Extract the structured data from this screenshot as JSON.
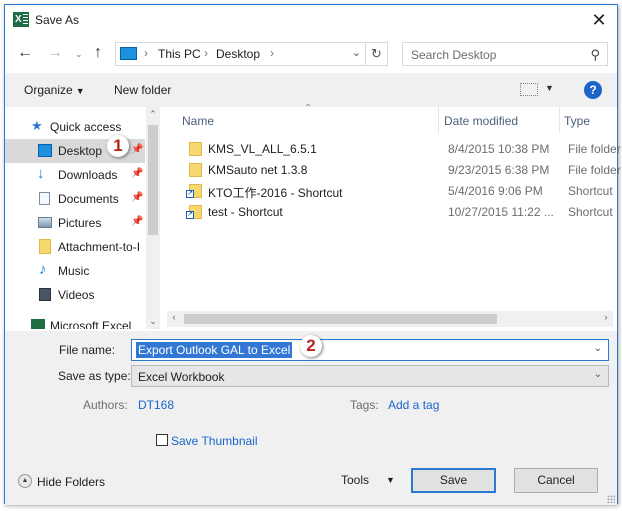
{
  "window": {
    "title": "Save As",
    "app_icon": "excel-icon",
    "accent": "#2a7ad2"
  },
  "navigation": {
    "back": "arrow-left-icon",
    "forward": "arrow-right-icon",
    "recent": "chevron-down-icon",
    "up": "arrow-up-icon",
    "breadcrumb": [
      "This PC",
      "Desktop"
    ],
    "search_placeholder": "Search Desktop"
  },
  "toolbar": {
    "organize": "Organize",
    "new_folder": "New folder"
  },
  "nav_pane": {
    "items": [
      {
        "label": "Quick access",
        "icon": "star-icon",
        "pinned": false
      },
      {
        "label": "Desktop",
        "icon": "desktop-icon",
        "pinned": true,
        "selected": true
      },
      {
        "label": "Downloads",
        "icon": "download-icon",
        "pinned": true
      },
      {
        "label": "Documents",
        "icon": "documents-icon",
        "pinned": true
      },
      {
        "label": "Pictures",
        "icon": "pictures-icon",
        "pinned": true
      },
      {
        "label": "Attachment-to-I",
        "icon": "folder-icon",
        "pinned": false
      },
      {
        "label": "Music",
        "icon": "music-icon",
        "pinned": false
      },
      {
        "label": "Videos",
        "icon": "videos-icon",
        "pinned": false
      },
      {
        "label": "Microsoft Excel",
        "icon": "excel-icon",
        "pinned": false
      }
    ]
  },
  "file_list": {
    "columns": [
      "Name",
      "Date modified",
      "Type"
    ],
    "rows": [
      {
        "name": "KMS_VL_ALL_6.5.1",
        "date": "8/4/2015 10:38 PM",
        "type": "File folder",
        "shortcut": false
      },
      {
        "name": "KMSauto net 1.3.8",
        "date": "9/23/2015 6:38 PM",
        "type": "File folder",
        "shortcut": false
      },
      {
        "name": "KTO工作-2016 - Shortcut",
        "date": "5/4/2016 9:06 PM",
        "type": "Shortcut",
        "shortcut": true
      },
      {
        "name": "test - Shortcut",
        "date": "10/27/2015 11:22 ...",
        "type": "Shortcut",
        "shortcut": true
      }
    ]
  },
  "form": {
    "file_name_label": "File name:",
    "file_name_value": "Export Outlook GAL to Excel",
    "save_type_label": "Save as type:",
    "save_type_value": "Excel Workbook",
    "authors_label": "Authors:",
    "authors_value": "DT168",
    "tags_label": "Tags:",
    "tags_value": "Add a tag",
    "thumbnail_label": "Save Thumbnail",
    "thumbnail_checked": false
  },
  "footer": {
    "hide_folders": "Hide Folders",
    "tools": "Tools",
    "save": "Save",
    "cancel": "Cancel"
  },
  "annotations": {
    "step1": "1",
    "step2": "2"
  }
}
